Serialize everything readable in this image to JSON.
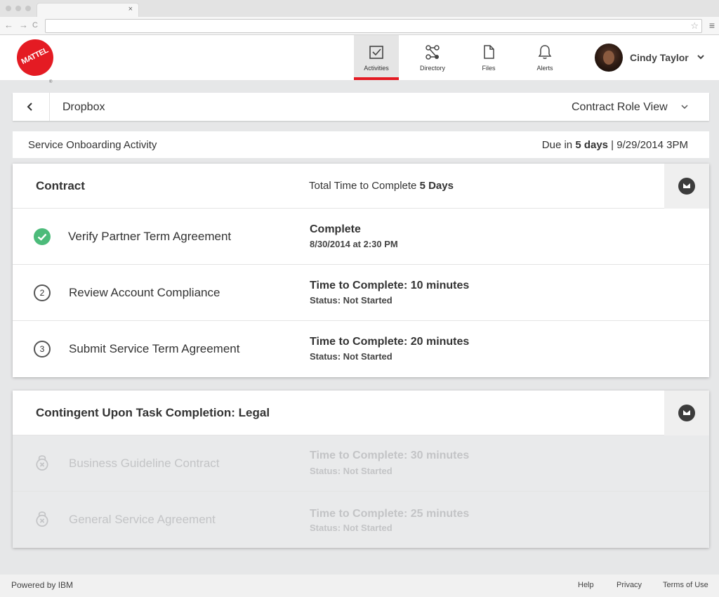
{
  "browser": {
    "tab_close": "×",
    "nav_back": "←",
    "nav_forward": "→",
    "nav_reload": "C",
    "url": "",
    "star": "☆",
    "menu": "≡"
  },
  "header": {
    "logo_text": "MATTEL",
    "logo_reg": "®",
    "nav": [
      {
        "label": "Activities",
        "icon": "checkbox-icon",
        "active": true
      },
      {
        "label": "Directory",
        "icon": "network-icon",
        "active": false
      },
      {
        "label": "Files",
        "icon": "file-icon",
        "active": false
      },
      {
        "label": "Alerts",
        "icon": "bell-icon",
        "active": false
      }
    ],
    "user_name": "Cindy Taylor"
  },
  "breadcrumb": {
    "title": "Dropbox",
    "view_selector": "Contract Role View"
  },
  "activity": {
    "title": "Service Onboarding Activity",
    "due_prefix": "Due in ",
    "due_days": "5 days",
    "due_separator": " | ",
    "due_date": "9/29/2014 3PM"
  },
  "contract": {
    "title": "Contract",
    "total_prefix": "Total Time to Complete ",
    "total_value": "5 Days",
    "tasks": [
      {
        "marker": "check",
        "name": "Verify Partner Term Agreement",
        "status": "Complete",
        "detail": "8/30/2014 at 2:30 PM"
      },
      {
        "marker": "2",
        "name": "Review Account Compliance",
        "status": "Time to Complete: 10 minutes",
        "detail": "Status: Not Started"
      },
      {
        "marker": "3",
        "name": "Submit Service Term Agreement",
        "status": "Time to Complete: 20 minutes",
        "detail": "Status: Not Started"
      }
    ]
  },
  "contingent": {
    "title": "Contingent Upon Task Completion: Legal",
    "tasks": [
      {
        "marker": "lock",
        "name": "Business Guideline Contract",
        "status": "Time to Complete: 30 minutes",
        "detail": "Status: Not Started"
      },
      {
        "marker": "lock",
        "name": "General Service Agreement",
        "status": "Time to Complete: 25 minutes",
        "detail": "Status: Not Started"
      }
    ]
  },
  "footer": {
    "powered_by": "Powered by IBM",
    "links": [
      "Help",
      "Privacy",
      "Terms of Use"
    ]
  },
  "colors": {
    "brand_red": "#e41b23",
    "check_green": "#4cbb7a",
    "background": "#e6e7e8"
  }
}
